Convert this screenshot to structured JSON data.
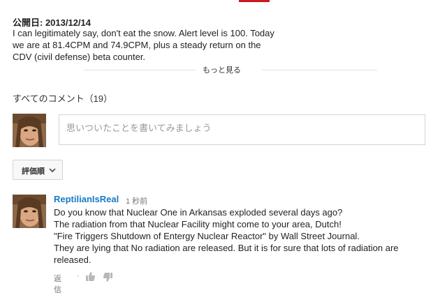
{
  "video": {
    "published_label": "公開日: 2013/12/14",
    "description_lines": [
      "I can legitimately say, don't eat the snow. Alert level is 100. Today",
      "we are at 81.4CPM and 74.9CPM, plus a steady return on the",
      "CDV (civil defense) beta counter."
    ],
    "show_more_label": "もっと見る"
  },
  "comments": {
    "header": "すべてのコメント（19）",
    "compose_placeholder": "思いついたことを書いてみましょう",
    "sort_label": "評価順",
    "items": [
      {
        "author": "ReptilianIsReal",
        "time": "1 秒前",
        "lines": [
          "Do you know that Nuclear One in Arkansas exploded several days ago?",
          "The radiation from that Nuclear Facility might come to your area, Dutch!",
          "\"Fire Triggers Shutdown of Entergy Nuclear Reactor\" by Wall Street Journal.",
          "They are lying that No radiation are released. But it is for sure that lots of radiation are",
          "released."
        ],
        "reply_label": "返信",
        "separator": "·"
      }
    ]
  },
  "colors": {
    "accent": "#cc181e",
    "author_link": "#167ac6"
  }
}
